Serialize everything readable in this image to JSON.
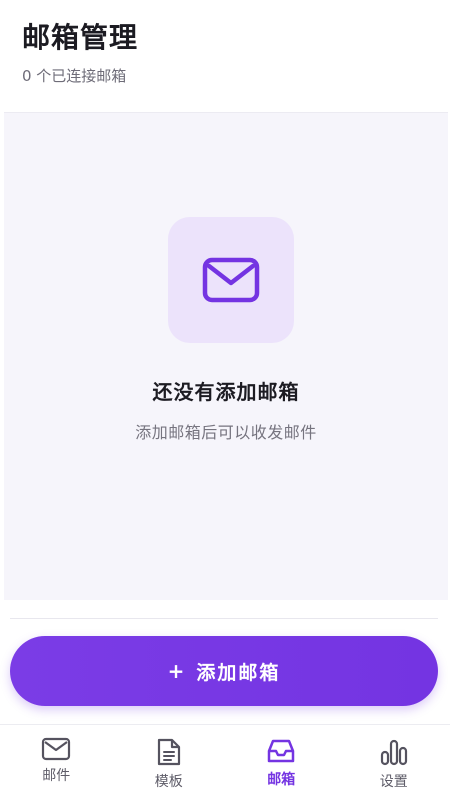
{
  "header": {
    "title": "邮箱管理",
    "subtitle": "0 个已连接邮箱"
  },
  "empty_state": {
    "icon": "mail-icon",
    "title": "还没有添加邮箱",
    "description": "添加邮箱后可以收发邮件"
  },
  "add_button": {
    "plus": "+",
    "label": "添加邮箱"
  },
  "tabbar": {
    "items": [
      {
        "label": "邮件",
        "icon": "mail-icon",
        "active": false
      },
      {
        "label": "模板",
        "icon": "document-icon",
        "active": false
      },
      {
        "label": "邮箱",
        "icon": "inbox-icon",
        "active": true
      },
      {
        "label": "设置",
        "icon": "chart-icon",
        "active": false
      }
    ]
  },
  "colors": {
    "accent": "#7434e2",
    "accent_light": "#ece3fb",
    "panel_bg": "#f6f5fb",
    "text_primary": "#1c1b22",
    "text_secondary": "#76747f"
  }
}
